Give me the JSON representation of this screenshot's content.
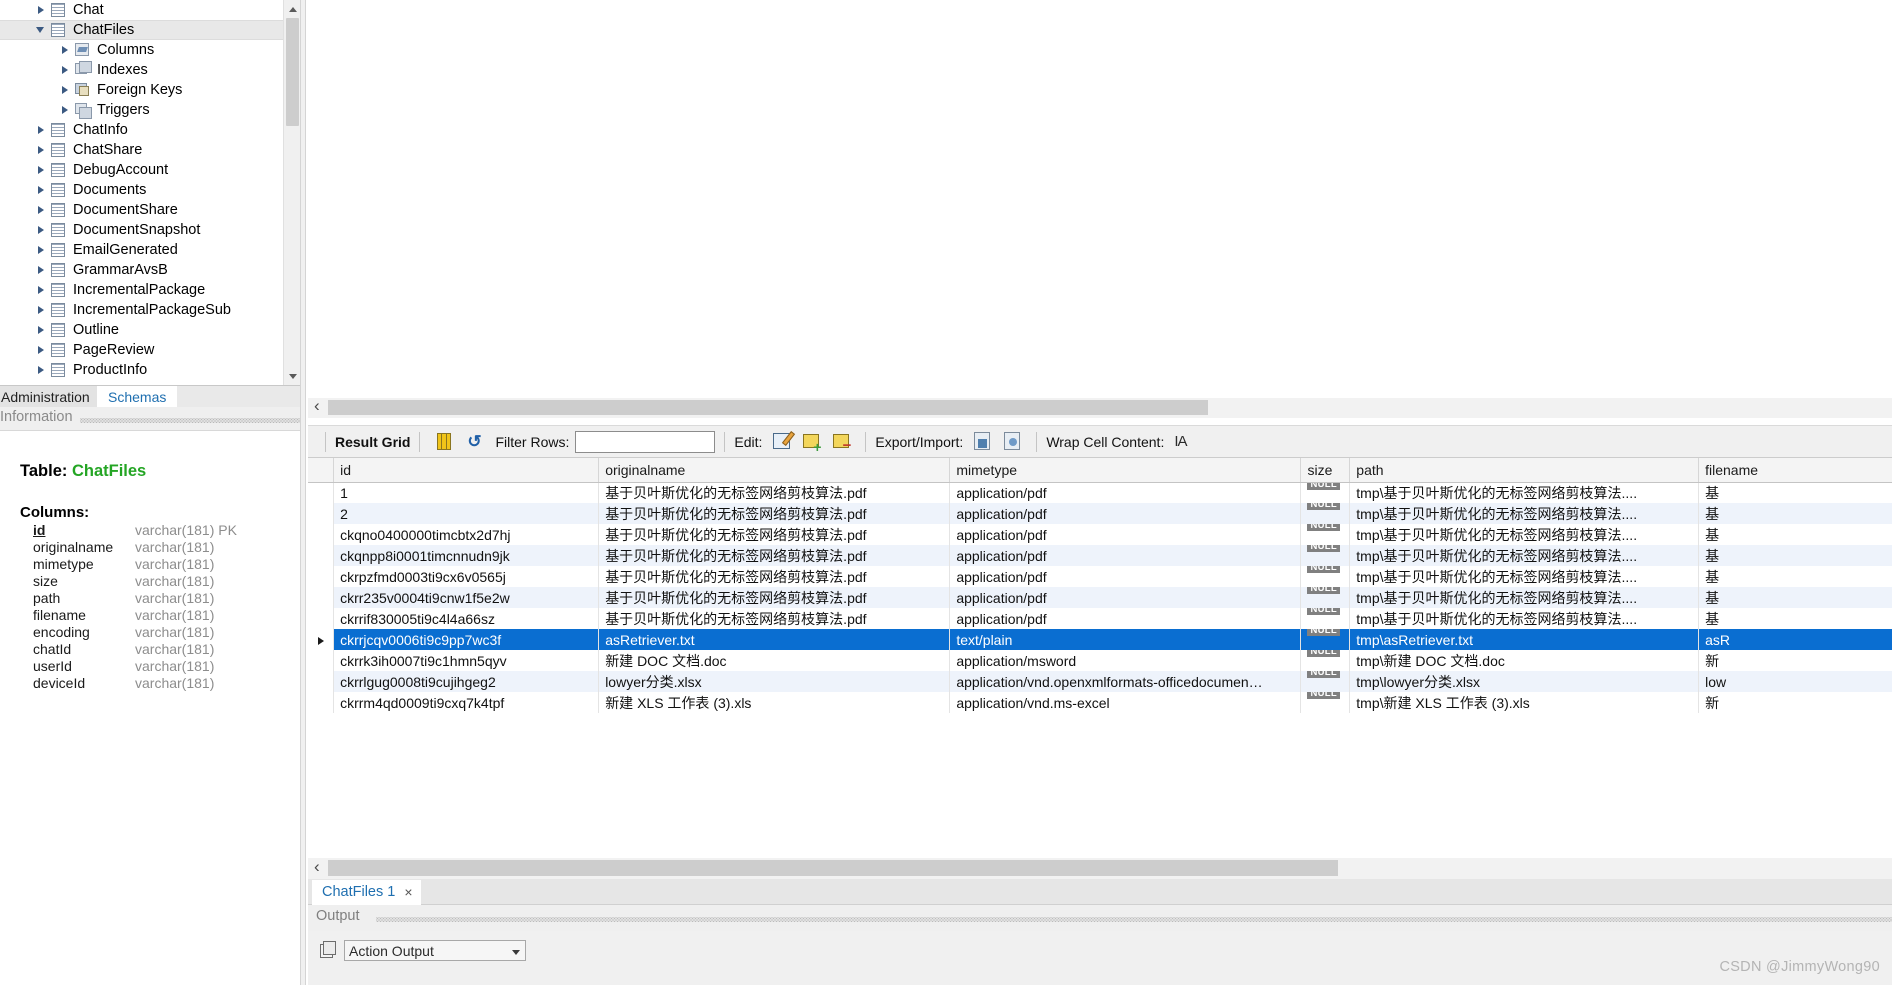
{
  "sidebar": {
    "tree_items": [
      {
        "label": "Chat",
        "indent": 0,
        "icon": "table-icon",
        "expanded": false,
        "selected": false
      },
      {
        "label": "ChatFiles",
        "indent": 0,
        "icon": "table-icon",
        "expanded": true,
        "selected": true
      },
      {
        "label": "Columns",
        "indent": 1,
        "icon": "columns-icon",
        "expanded": false,
        "selected": false
      },
      {
        "label": "Indexes",
        "indent": 1,
        "icon": "indexes-icon",
        "expanded": false,
        "selected": false
      },
      {
        "label": "Foreign Keys",
        "indent": 1,
        "icon": "foreign-keys-icon",
        "expanded": false,
        "selected": false
      },
      {
        "label": "Triggers",
        "indent": 1,
        "icon": "triggers-icon",
        "expanded": false,
        "selected": false
      },
      {
        "label": "ChatInfo",
        "indent": 0,
        "icon": "table-icon",
        "expanded": false,
        "selected": false
      },
      {
        "label": "ChatShare",
        "indent": 0,
        "icon": "table-icon",
        "expanded": false,
        "selected": false
      },
      {
        "label": "DebugAccount",
        "indent": 0,
        "icon": "table-icon",
        "expanded": false,
        "selected": false
      },
      {
        "label": "Documents",
        "indent": 0,
        "icon": "table-icon",
        "expanded": false,
        "selected": false
      },
      {
        "label": "DocumentShare",
        "indent": 0,
        "icon": "table-icon",
        "expanded": false,
        "selected": false
      },
      {
        "label": "DocumentSnapshot",
        "indent": 0,
        "icon": "table-icon",
        "expanded": false,
        "selected": false
      },
      {
        "label": "EmailGenerated",
        "indent": 0,
        "icon": "table-icon",
        "expanded": false,
        "selected": false
      },
      {
        "label": "GrammarAvsB",
        "indent": 0,
        "icon": "table-icon",
        "expanded": false,
        "selected": false
      },
      {
        "label": "IncrementalPackage",
        "indent": 0,
        "icon": "table-icon",
        "expanded": false,
        "selected": false
      },
      {
        "label": "IncrementalPackageSub",
        "indent": 0,
        "icon": "table-icon",
        "expanded": false,
        "selected": false
      },
      {
        "label": "Outline",
        "indent": 0,
        "icon": "table-icon",
        "expanded": false,
        "selected": false
      },
      {
        "label": "PageReview",
        "indent": 0,
        "icon": "table-icon",
        "expanded": false,
        "selected": false
      },
      {
        "label": "ProductInfo",
        "indent": 0,
        "icon": "table-icon",
        "expanded": false,
        "selected": false
      }
    ],
    "tabs": [
      {
        "label": "Administration",
        "active": false
      },
      {
        "label": "Schemas",
        "active": true
      }
    ],
    "information_header": "Information",
    "table_info": {
      "table_prefix": "Table:",
      "table_name": "ChatFiles",
      "columns_header": "Columns:",
      "columns": [
        {
          "name": "id",
          "type": "varchar(181) PK",
          "pk": true
        },
        {
          "name": "originalname",
          "type": "varchar(181)",
          "pk": false
        },
        {
          "name": "mimetype",
          "type": "varchar(181)",
          "pk": false
        },
        {
          "name": "size",
          "type": "varchar(181)",
          "pk": false
        },
        {
          "name": "path",
          "type": "varchar(181)",
          "pk": false
        },
        {
          "name": "filename",
          "type": "varchar(181)",
          "pk": false
        },
        {
          "name": "encoding",
          "type": "varchar(181)",
          "pk": false
        },
        {
          "name": "chatId",
          "type": "varchar(181)",
          "pk": false
        },
        {
          "name": "userId",
          "type": "varchar(181)",
          "pk": false
        },
        {
          "name": "deviceId",
          "type": "varchar(181)",
          "pk": false
        }
      ]
    }
  },
  "result_toolbar": {
    "result_grid_label": "Result Grid",
    "filter_rows_label": "Filter Rows:",
    "filter_value": "",
    "edit_label": "Edit:",
    "export_import_label": "Export/Import:",
    "wrap_cell_content_label": "Wrap Cell Content:",
    "icons": {
      "grid_view": "grid-view-icon",
      "refresh": "refresh-icon",
      "edit_pencil": "edit-pencil-icon",
      "row_insert": "row-insert-icon",
      "row_delete": "row-delete-icon",
      "export_recordset": "export-recordset-icon",
      "import_recordset": "import-recordset-icon",
      "wrap_toggle": "wrap-cell-icon"
    }
  },
  "grid": {
    "columns": [
      "id",
      "originalname",
      "mimetype",
      "size",
      "path",
      "filename"
    ],
    "null_label": "NULL",
    "rows": [
      {
        "id": "1",
        "originalname": "基于贝叶斯优化的无标签网络剪枝算法.pdf",
        "mimetype": "application/pdf",
        "size": "NULL",
        "path": "tmp\\基于贝叶斯优化的无标签网络剪枝算法....",
        "filename": "基",
        "selected": false
      },
      {
        "id": "2",
        "originalname": "基于贝叶斯优化的无标签网络剪枝算法.pdf",
        "mimetype": "application/pdf",
        "size": "NULL",
        "path": "tmp\\基于贝叶斯优化的无标签网络剪枝算法....",
        "filename": "基",
        "selected": false
      },
      {
        "id": "ckqno0400000timcbtx2d7hj",
        "originalname": "基于贝叶斯优化的无标签网络剪枝算法.pdf",
        "mimetype": "application/pdf",
        "size": "NULL",
        "path": "tmp\\基于贝叶斯优化的无标签网络剪枝算法....",
        "filename": "基",
        "selected": false
      },
      {
        "id": "ckqnpp8i0001timcnnudn9jk",
        "originalname": "基于贝叶斯优化的无标签网络剪枝算法.pdf",
        "mimetype": "application/pdf",
        "size": "NULL",
        "path": "tmp\\基于贝叶斯优化的无标签网络剪枝算法....",
        "filename": "基",
        "selected": false
      },
      {
        "id": "ckrpzfmd0003ti9cx6v0565j",
        "originalname": "基于贝叶斯优化的无标签网络剪枝算法.pdf",
        "mimetype": "application/pdf",
        "size": "NULL",
        "path": "tmp\\基于贝叶斯优化的无标签网络剪枝算法....",
        "filename": "基",
        "selected": false
      },
      {
        "id": "ckrr235v0004ti9cnw1f5e2w",
        "originalname": "基于贝叶斯优化的无标签网络剪枝算法.pdf",
        "mimetype": "application/pdf",
        "size": "NULL",
        "path": "tmp\\基于贝叶斯优化的无标签网络剪枝算法....",
        "filename": "基",
        "selected": false
      },
      {
        "id": "ckrrif830005ti9c4l4a66sz",
        "originalname": "基于贝叶斯优化的无标签网络剪枝算法.pdf",
        "mimetype": "application/pdf",
        "size": "NULL",
        "path": "tmp\\基于贝叶斯优化的无标签网络剪枝算法....",
        "filename": "基",
        "selected": false
      },
      {
        "id": "ckrrjcqv0006ti9c9pp7wc3f",
        "originalname": "asRetriever.txt",
        "mimetype": "text/plain",
        "size": "NULL",
        "path": "tmp\\asRetriever.txt",
        "filename": "asR",
        "selected": true
      },
      {
        "id": "ckrrk3ih0007ti9c1hmn5qyv",
        "originalname": "新建 DOC 文档.doc",
        "mimetype": "application/msword",
        "size": "NULL",
        "path": "tmp\\新建 DOC 文档.doc",
        "filename": "新",
        "selected": false
      },
      {
        "id": "ckrrlgug0008ti9cujihgeg2",
        "originalname": "lowyer分类.xlsx",
        "mimetype": "application/vnd.openxmlformats-officedocumen…",
        "size": "NULL",
        "path": "tmp\\lowyer分类.xlsx",
        "filename": "low",
        "selected": false
      },
      {
        "id": "ckrrm4qd0009ti9cxq7k4tpf",
        "originalname": "新建 XLS 工作表 (3).xls",
        "mimetype": "application/vnd.ms-excel",
        "size": "NULL",
        "path": "tmp\\新建 XLS 工作表 (3).xls",
        "filename": "新",
        "selected": false
      }
    ]
  },
  "result_tab": {
    "label": "ChatFiles 1",
    "close": "×"
  },
  "output": {
    "header": "Output",
    "selected_view": "Action Output"
  },
  "watermark": "CSDN @JimmyWong90"
}
